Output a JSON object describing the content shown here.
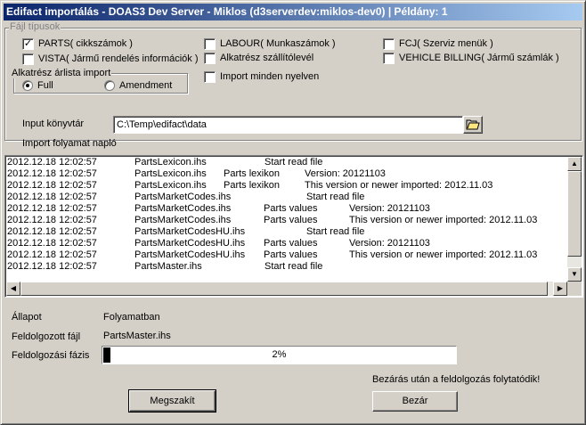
{
  "window": {
    "title": "Edifact importálás - DOAS3 Dev Server - Miklos (d3serverdev:miklos-dev0) | Példány: 1"
  },
  "file_types": {
    "legend": "Fájl típusok",
    "options": [
      {
        "label": "PARTS( cikkszámok )",
        "checked": true
      },
      {
        "label": "VISTA( Jármű rendelés információk )",
        "checked": false
      },
      {
        "label": "LABOUR( Munkaszámok )",
        "checked": false
      },
      {
        "label": "Alkatrész szállítólevél",
        "checked": false
      },
      {
        "label": "Import minden nyelven",
        "checked": false
      },
      {
        "label": "FCJ( Szerviz menük )",
        "checked": false
      },
      {
        "label": "VEHICLE BILLING( Jármű számlák )",
        "checked": false
      }
    ]
  },
  "price_list": {
    "legend": "Alkatrész árlista import",
    "options": [
      {
        "label": "Full",
        "selected": true
      },
      {
        "label": "Amendment",
        "selected": false
      }
    ]
  },
  "input_dir": {
    "label": "Input könyvtár",
    "value": "C:\\Temp\\edifact\\data",
    "browse_icon": "folder-open-icon"
  },
  "log": {
    "label": "Import folyamat napló",
    "rows": [
      [
        "2012.12.18 12:02:57",
        "PartsLexicon.ihs",
        "",
        "Start read file"
      ],
      [
        "2012.12.18 12:02:57",
        "PartsLexicon.ihs",
        "Parts lexikon",
        "Version: 20121103"
      ],
      [
        "2012.12.18 12:02:57",
        "PartsLexicon.ihs",
        "Parts lexikon",
        "This version or newer imported: 2012.11.03"
      ],
      [
        "2012.12.18 12:02:57",
        "PartsMarketCodes.ihs",
        "",
        "Start read file"
      ],
      [
        "2012.12.18 12:02:57",
        "PartsMarketCodes.ihs",
        "Parts values",
        "Version: 20121103"
      ],
      [
        "2012.12.18 12:02:57",
        "PartsMarketCodes.ihs",
        "Parts values",
        "This version or newer imported: 2012.11.03"
      ],
      [
        "2012.12.18 12:02:57",
        "PartsMarketCodesHU.ihs",
        "",
        "Start read file"
      ],
      [
        "2012.12.18 12:02:57",
        "PartsMarketCodesHU.ihs",
        "Parts values",
        "Version: 20121103"
      ],
      [
        "2012.12.18 12:02:57",
        "PartsMarketCodesHU.ihs",
        "Parts values",
        "This version or newer imported: 2012.11.03"
      ],
      [
        "2012.12.18 12:02:57",
        "PartsMaster.ihs",
        "",
        "Start read file"
      ]
    ]
  },
  "status": {
    "state_label": "Állapot",
    "state_value": "Folyamatban",
    "file_label": "Feldolgozott fájl",
    "file_value": "PartsMaster.ihs",
    "phase_label": "Feldolgozási fázis",
    "progress_percent": 2,
    "progress_text": "2%",
    "note": "Bezárás után a feldolgozás folytatódik!"
  },
  "buttons": {
    "cancel": "Megszakít",
    "close": "Bezár"
  }
}
